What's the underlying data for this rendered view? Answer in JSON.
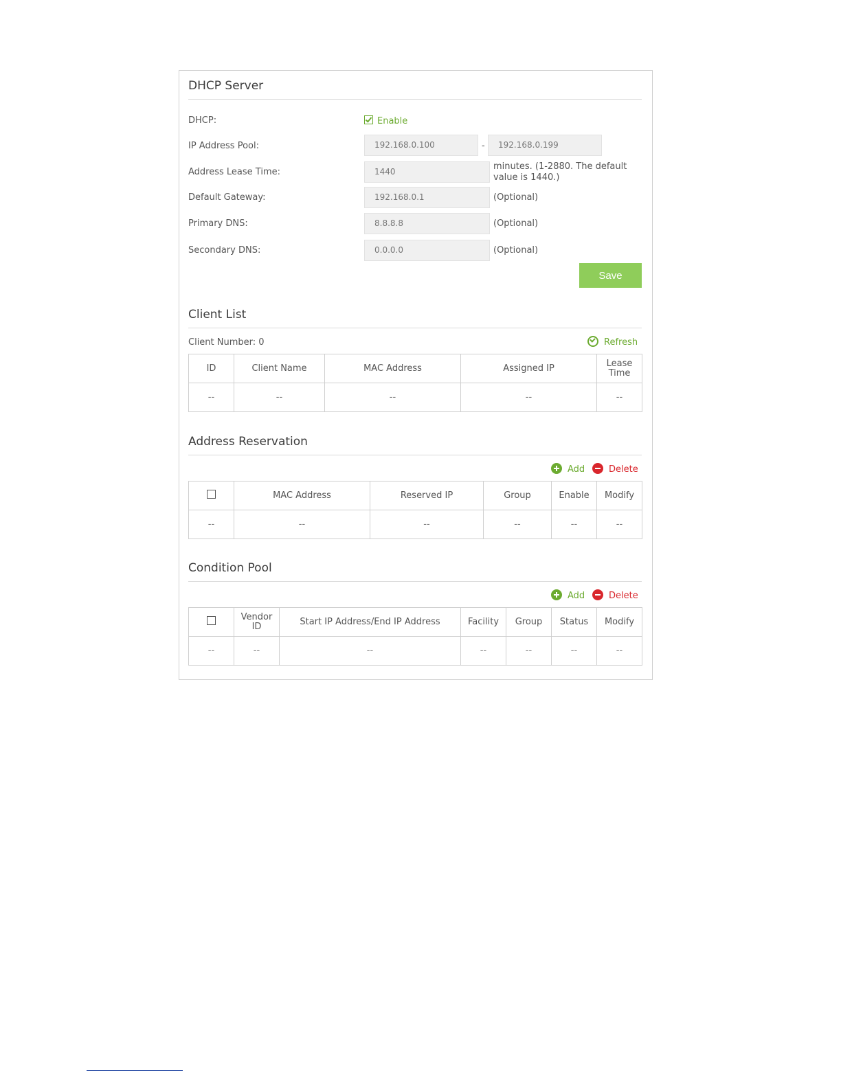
{
  "dhcp_server": {
    "title": "DHCP Server",
    "dhcp_label": "DHCP:",
    "enable_label": "Enable",
    "ip_pool_label": "IP Address Pool:",
    "ip_pool_start": "192.168.0.100",
    "ip_pool_sep": "-",
    "ip_pool_end": "192.168.0.199",
    "lease_label": "Address Lease Time:",
    "lease_value": "1440",
    "lease_note_1": "minutes. (1-2880. The default",
    "lease_note_2": "value is 1440.)",
    "gateway_label": "Default Gateway:",
    "gateway_value": "192.168.0.1",
    "primary_dns_label": "Primary DNS:",
    "primary_dns_value": "8.8.8.8",
    "secondary_dns_label": "Secondary DNS:",
    "secondary_dns_value": "0.0.0.0",
    "optional": "(Optional)",
    "save_label": "Save"
  },
  "client_list": {
    "title": "Client List",
    "count_text": "Client Number: 0",
    "refresh_label": "Refresh",
    "headers": [
      "ID",
      "Client Name",
      "MAC Address",
      "Assigned IP",
      "Lease Time"
    ],
    "row": [
      "--",
      "--",
      "--",
      "--",
      "--"
    ]
  },
  "address_reservation": {
    "title": "Address Reservation",
    "add_label": "Add",
    "delete_label": "Delete",
    "headers": [
      "MAC Address",
      "Reserved IP",
      "Group",
      "Enable",
      "Modify"
    ],
    "row": [
      "--",
      "--",
      "--",
      "--",
      "--",
      "--"
    ]
  },
  "condition_pool": {
    "title": "Condition Pool",
    "add_label": "Add",
    "delete_label": "Delete",
    "headers": [
      "Vendor ID",
      "Start IP Address/End IP Address",
      "Facility",
      "Group",
      "Status",
      "Modify"
    ],
    "row": [
      "--",
      "--",
      "--",
      "--",
      "--",
      "--",
      "--"
    ]
  },
  "colors": {
    "accent_green": "#6cab30",
    "save_button": "#8fcd5a",
    "delete_red": "#d9262c"
  }
}
